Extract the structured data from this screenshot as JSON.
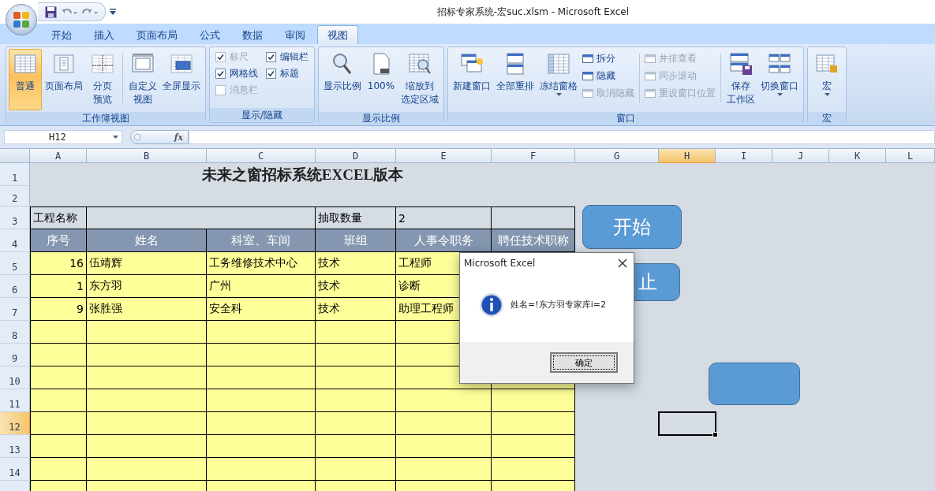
{
  "window": {
    "title": "招标专家系统-宏suc.xlsm - Microsoft Excel"
  },
  "ribbon": {
    "tabs": [
      {
        "label": "开始",
        "selected": false
      },
      {
        "label": "插入",
        "selected": false
      },
      {
        "label": "页面布局",
        "selected": false
      },
      {
        "label": "公式",
        "selected": false
      },
      {
        "label": "数据",
        "selected": false
      },
      {
        "label": "审阅",
        "selected": false
      },
      {
        "label": "视图",
        "selected": true
      }
    ],
    "groups": [
      {
        "label": "工作簿视图",
        "items": [
          {
            "kind": "large",
            "label": "普通",
            "selected": true,
            "dropdown": false
          },
          {
            "kind": "large",
            "label": "页面布局",
            "selected": false,
            "dropdown": false
          },
          {
            "kind": "large",
            "label": [
              "分页",
              "预览"
            ],
            "selected": false,
            "dropdown": false
          },
          {
            "kind": "separator"
          },
          {
            "kind": "large",
            "label": [
              "自定义",
              "视图"
            ],
            "selected": false,
            "dropdown": false
          },
          {
            "kind": "large",
            "label": "全屏显示",
            "selected": false,
            "dropdown": false
          }
        ]
      },
      {
        "label": "显示/隐藏",
        "items": [
          {
            "kind": "check",
            "label": "标尺",
            "checked": true,
            "disabled": true
          },
          {
            "kind": "check",
            "label": "编辑栏",
            "checked": true,
            "disabled": false
          },
          {
            "kind": "check",
            "label": "网格线",
            "checked": true,
            "disabled": false
          },
          {
            "kind": "check",
            "label": "标题",
            "checked": true,
            "disabled": false
          },
          {
            "kind": "check",
            "label": "消息栏",
            "checked": false,
            "disabled": true
          }
        ]
      },
      {
        "label": "显示比例",
        "items": [
          {
            "kind": "large",
            "label": "显示比例",
            "dropdown": false
          },
          {
            "kind": "large",
            "label": "100%",
            "dropdown": false
          },
          {
            "kind": "large",
            "label": [
              "缩放到",
              "选定区域"
            ],
            "dropdown": false
          }
        ]
      },
      {
        "label": "窗口",
        "items": [
          {
            "kind": "large",
            "label": "新建窗口",
            "dropdown": false
          },
          {
            "kind": "large",
            "label": "全部重排",
            "dropdown": false
          },
          {
            "kind": "large",
            "label": "冻结窗格",
            "dropdown": true
          },
          {
            "kind": "stack",
            "items": [
              {
                "label": "拆分",
                "disabled": false
              },
              {
                "label": "隐藏",
                "disabled": false
              },
              {
                "label": "取消隐藏",
                "disabled": true
              }
            ]
          },
          {
            "kind": "separator"
          },
          {
            "kind": "stack",
            "items": [
              {
                "label": "并排查看",
                "disabled": true
              },
              {
                "label": "同步滚动",
                "disabled": true
              },
              {
                "label": "重设窗口位置",
                "disabled": true
              }
            ]
          },
          {
            "kind": "separator"
          },
          {
            "kind": "large",
            "label": [
              "保存",
              "工作区"
            ],
            "dropdown": false
          },
          {
            "kind": "large",
            "label": "切换窗口",
            "dropdown": true
          }
        ]
      },
      {
        "label": "宏",
        "items": [
          {
            "kind": "large",
            "label": "宏",
            "dropdown": true
          }
        ]
      }
    ]
  },
  "formula_bar": {
    "name_box": "H12",
    "fx_label": "fx"
  },
  "sheet": {
    "columns": [
      {
        "label": "A",
        "selected": false
      },
      {
        "label": "B",
        "selected": false
      },
      {
        "label": "C",
        "selected": false
      },
      {
        "label": "D",
        "selected": false
      },
      {
        "label": "E",
        "selected": false
      },
      {
        "label": "F",
        "selected": false
      },
      {
        "label": "G",
        "selected": false
      },
      {
        "label": "H",
        "selected": true
      },
      {
        "label": "I",
        "selected": false
      },
      {
        "label": "J",
        "selected": false
      },
      {
        "label": "K",
        "selected": false
      },
      {
        "label": "L",
        "selected": false
      }
    ],
    "rows": [
      {
        "label": "1",
        "selected": false
      },
      {
        "label": "2",
        "selected": false
      },
      {
        "label": "3",
        "selected": false
      },
      {
        "label": "4",
        "selected": false
      },
      {
        "label": "5",
        "selected": false
      },
      {
        "label": "6",
        "selected": false
      },
      {
        "label": "7",
        "selected": false
      },
      {
        "label": "8",
        "selected": false
      },
      {
        "label": "9",
        "selected": false
      },
      {
        "label": "10",
        "selected": false
      },
      {
        "label": "11",
        "selected": false
      },
      {
        "label": "12",
        "selected": true
      },
      {
        "label": "13",
        "selected": false
      },
      {
        "label": "14",
        "selected": false
      }
    ],
    "title": "未来之窗招标系统EXCEL版本",
    "project_label": "工程名称",
    "count_label": "抽取数量",
    "count_value": "2",
    "table": {
      "columns": [
        "序号",
        "姓名",
        "科室、车间",
        "班组",
        "人事令职务",
        "聘任技术职称"
      ],
      "rows": [
        [
          "16",
          "伍靖辉",
          "工务维修技术中心",
          "技术",
          "工程师"
        ],
        [
          "1",
          "东方羽",
          "广州",
          "技术",
          "诊断"
        ],
        [
          "9",
          "张胜强",
          "安全科",
          "技术",
          "助理工程师"
        ]
      ]
    },
    "shapes": [
      {
        "kind": "button",
        "label": "开始"
      },
      {
        "kind": "button",
        "label": "止"
      },
      {
        "kind": "blank"
      }
    ]
  },
  "dialog": {
    "title": "Microsoft Excel",
    "message": "姓名=!东方羽专家库i=2",
    "button": "确定"
  }
}
